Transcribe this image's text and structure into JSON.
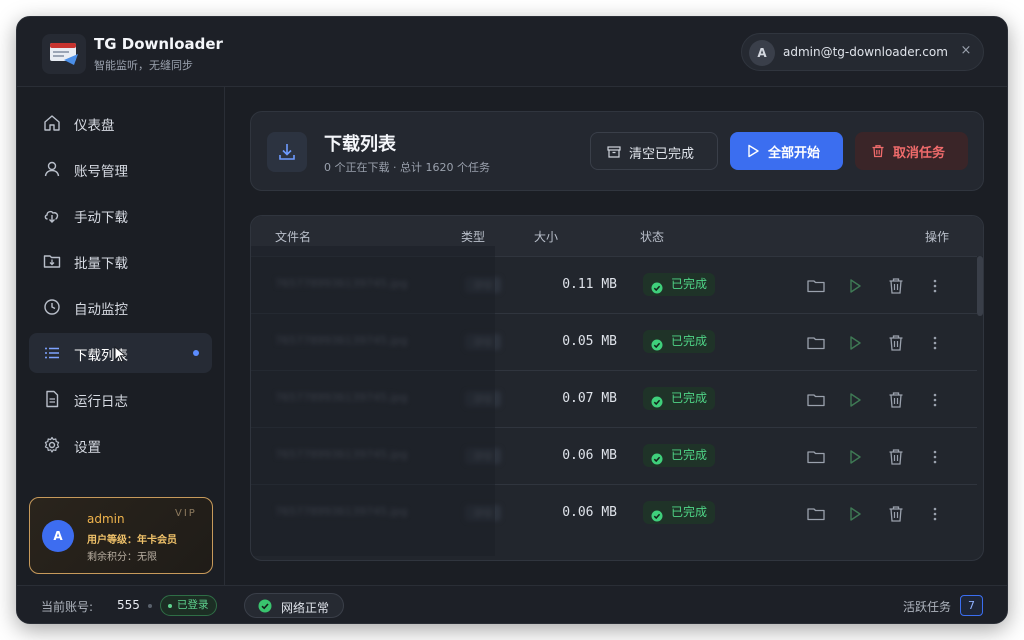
{
  "app": {
    "title": "TG Downloader",
    "subtitle": "智能监听，无缝同步"
  },
  "account": {
    "avatar_letter": "A",
    "email": "admin@tg-downloader.com",
    "close_glyph": "×"
  },
  "sidebar": {
    "items": [
      {
        "label": "仪表盘",
        "icon": "home-icon"
      },
      {
        "label": "账号管理",
        "icon": "user-icon"
      },
      {
        "label": "手动下载",
        "icon": "cloud-download-icon"
      },
      {
        "label": "批量下载",
        "icon": "folder-download-icon"
      },
      {
        "label": "自动监控",
        "icon": "clock-icon"
      },
      {
        "label": "下载列表",
        "icon": "list-icon",
        "active": true
      },
      {
        "label": "运行日志",
        "icon": "document-icon"
      },
      {
        "label": "设置",
        "icon": "gear-icon"
      }
    ],
    "user_card": {
      "avatar_letter": "A",
      "name": "admin",
      "level": "用户等级：年卡会员",
      "points": "剩余积分：无限",
      "tag": "VIP"
    }
  },
  "download_list": {
    "title": "下载列表",
    "summary": "0 个正在下载 · 总计 1620 个任务",
    "buttons": {
      "clear": "清空已完成",
      "start_all": "全部开始",
      "cancel": "取消任务"
    }
  },
  "table": {
    "columns": {
      "name": "文件名",
      "type": "类型",
      "size": "大小",
      "status": "状态",
      "actions": "操作"
    },
    "rows": [
      {
        "name": "7657789936139745.jpg",
        "type": "jpg",
        "size": "0.11 MB",
        "status": "已完成"
      },
      {
        "name": "7657789936139745.jpg",
        "type": "jpg",
        "size": "0.05 MB",
        "status": "已完成"
      },
      {
        "name": "7657789936139745.jpg",
        "type": "jpg",
        "size": "0.07 MB",
        "status": "已完成"
      },
      {
        "name": "7657789936139745.jpg",
        "type": "jpg",
        "size": "0.06 MB",
        "status": "已完成"
      },
      {
        "name": "7657789936139745.jpg",
        "type": "jpg",
        "size": "0.06 MB",
        "status": "已完成"
      }
    ]
  },
  "footer": {
    "current_account_label": "当前账号:",
    "current_account": "555",
    "logged_in": "已登录",
    "network": "网络正常",
    "active_tasks_label": "活跃任务",
    "active_tasks": "7"
  },
  "colors": {
    "accent": "#3b6ef0",
    "success": "#4fd486",
    "danger": "#ef6b6b",
    "vip": "#f0b44c"
  }
}
